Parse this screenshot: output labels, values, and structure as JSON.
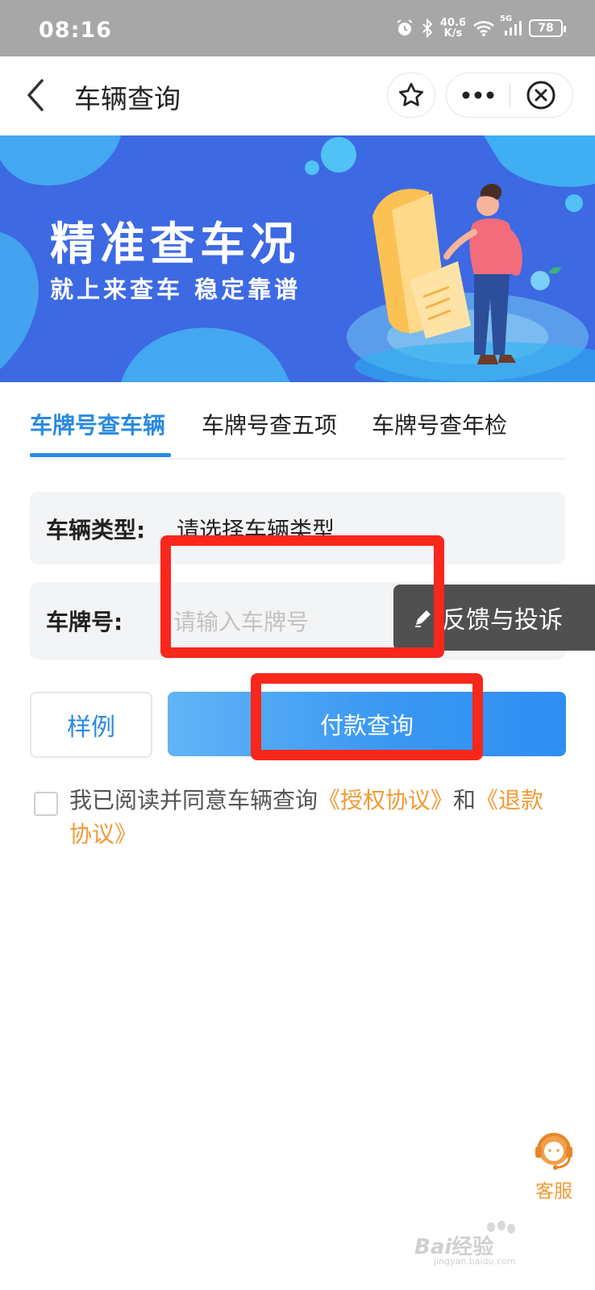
{
  "status_bar": {
    "time": "08:16",
    "net_speed_value": "40.6",
    "net_speed_unit": "K/s",
    "network": "5G",
    "battery": "78"
  },
  "nav": {
    "title": "车辆查询"
  },
  "banner": {
    "title": "精准查车况",
    "subtitle": "就上来查车 稳定靠谱"
  },
  "tabs": [
    {
      "label": "车牌号查车辆",
      "active": true
    },
    {
      "label": "车牌号查五项",
      "active": false
    },
    {
      "label": "车牌号查年检",
      "active": false
    }
  ],
  "form": {
    "vehicle_type_label": "车辆类型:",
    "vehicle_type_value": "请选择车辆类型",
    "plate_label": "车牌号:",
    "plate_placeholder": "请输入车牌号",
    "plate_value": ""
  },
  "feedback": {
    "label": "反馈与投诉"
  },
  "actions": {
    "sample_label": "样例",
    "pay_query_label": "付款查询"
  },
  "agreement": {
    "checked": false,
    "text_prefix": "我已阅读并同意车辆查询",
    "auth_link": "《授权协议》",
    "conjunction": "和",
    "refund_link": "《退款协议》"
  },
  "customer_service": {
    "label": "客服"
  },
  "watermark": {
    "brand": "Bai",
    "brand_suffix": "经验",
    "url": "jingyan.baidu.com"
  },
  "colors": {
    "accent": "#2a8ae0",
    "link": "#f29a34",
    "annotation": "#f8271b",
    "banner_bg": "#3d69e3"
  }
}
